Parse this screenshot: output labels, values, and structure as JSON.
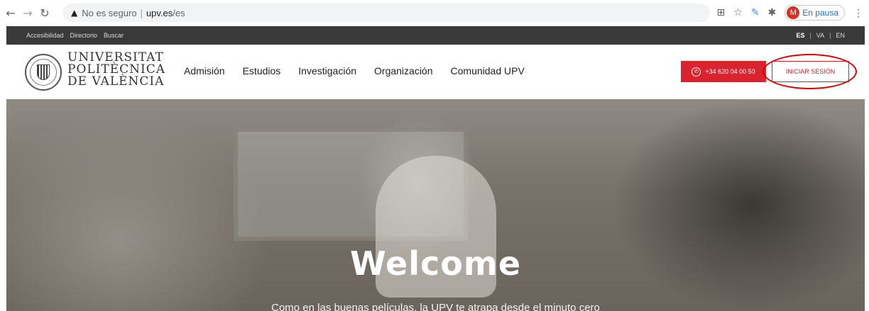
{
  "browser": {
    "security_label": "No es seguro",
    "url_host": "upv.es",
    "url_path": "/es",
    "profile_initial": "M",
    "profile_status": "En pausa",
    "icons": [
      "back-icon",
      "forward-icon",
      "reload-icon",
      "warning-icon",
      "grid-icon",
      "star-icon",
      "pen-icon",
      "puzzle-icon",
      "menu-icon"
    ]
  },
  "topbar": {
    "links": [
      "Accesibilidad",
      "Directorio",
      "Buscar"
    ],
    "languages": [
      "ES",
      "VA",
      "EN"
    ],
    "active_language": "ES"
  },
  "header": {
    "logo_lines": [
      "UNIVERSITAT",
      "POLITÈCNICA",
      "DE VALÈNCIA"
    ],
    "nav": [
      "Admisión",
      "Estudios",
      "Investigación",
      "Organización",
      "Comunidad UPV"
    ],
    "phone": "+34 620 04 00 50",
    "login": "INICIAR SESIÓN"
  },
  "hero": {
    "title": "Welcome",
    "subtitle": "Como en las buenas películas, la UPV te atrapa desde el minuto cero"
  },
  "colors": {
    "accent": "#d9232e",
    "topbar": "#3a3a3a",
    "annotation": "#e00000"
  }
}
